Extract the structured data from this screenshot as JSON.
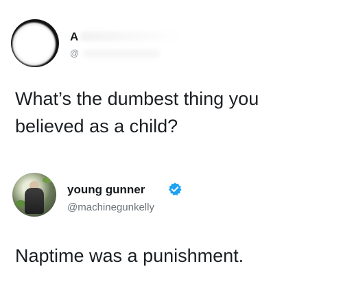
{
  "tweets": [
    {
      "name": "A",
      "handle": "@",
      "text": "What’s the dumbest thing you\nbelieved as a child?"
    },
    {
      "name": "young gunner",
      "handle": "@machinegunkelly",
      "verified": true,
      "text": "Naptime was a punishment."
    }
  ],
  "colors": {
    "verified_badge": "#1da1f2",
    "text": "#14171a",
    "handle": "#6b7176"
  }
}
